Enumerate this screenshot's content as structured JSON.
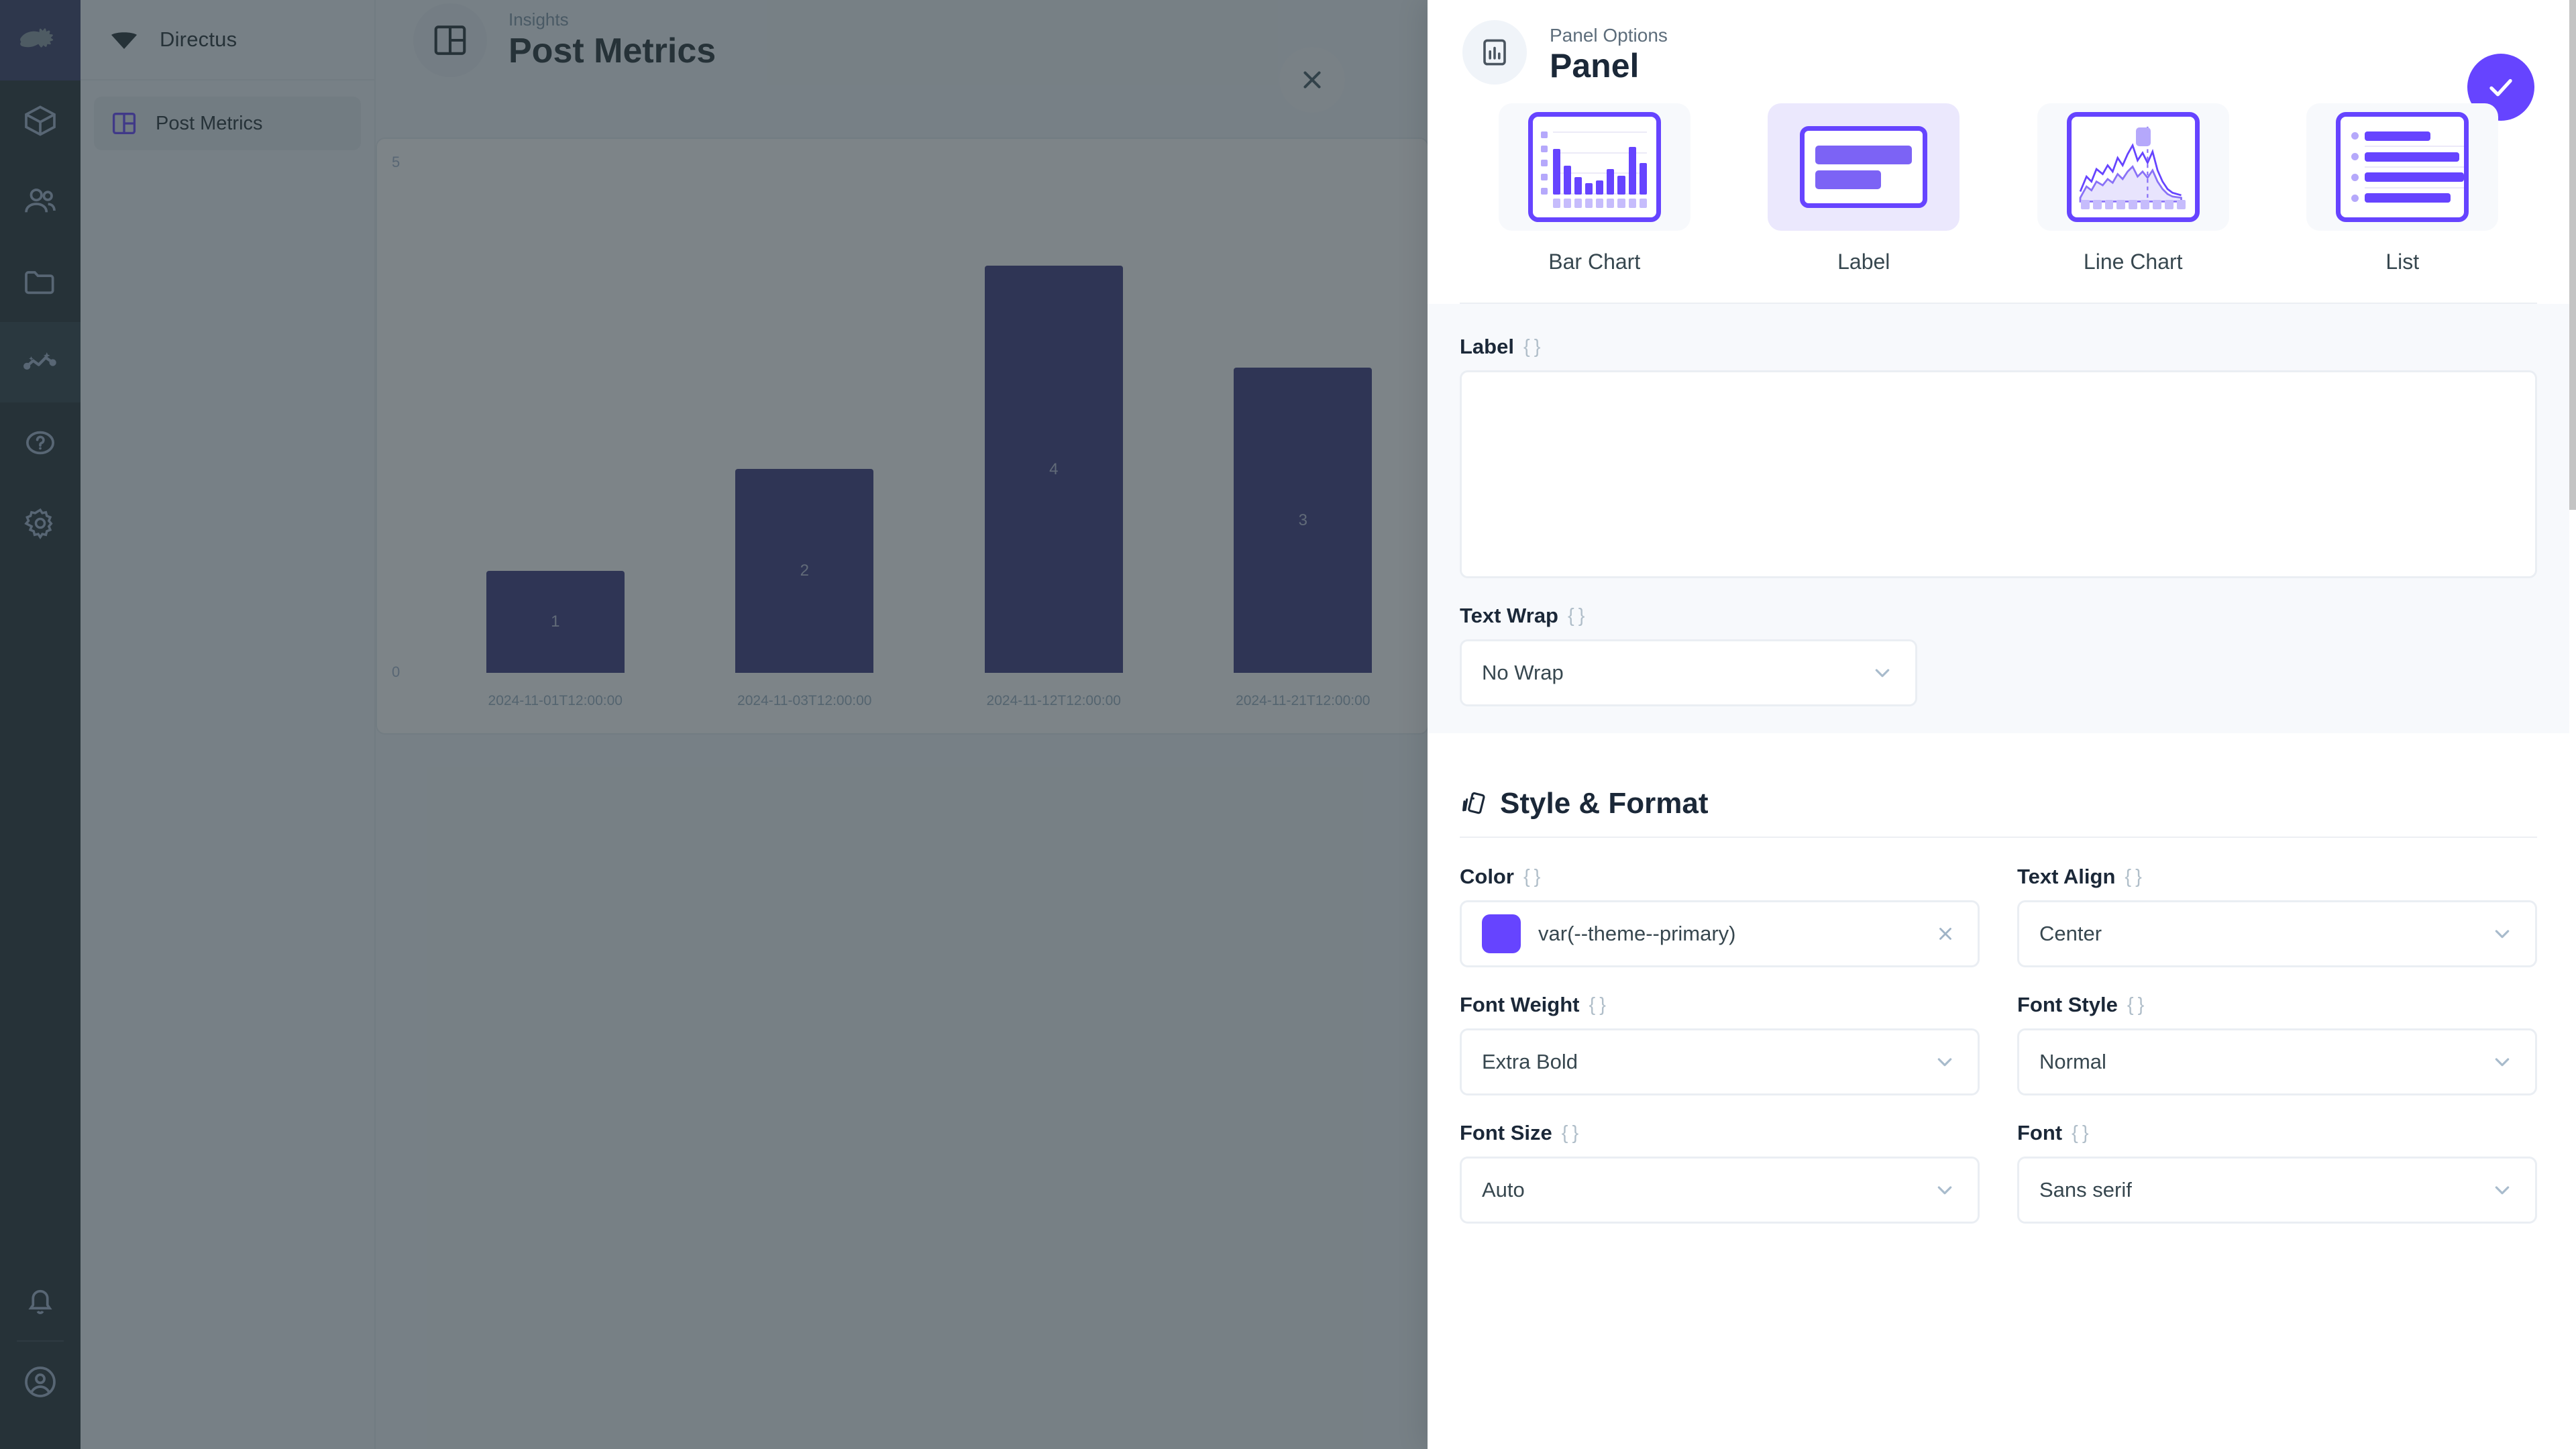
{
  "module_bar": {
    "logo_name": "directus-rabbit-logo",
    "items": [
      {
        "name": "content-module",
        "icon": "box-icon",
        "active": false
      },
      {
        "name": "users-module",
        "icon": "people-icon",
        "active": false
      },
      {
        "name": "files-module",
        "icon": "folder-icon",
        "active": false
      },
      {
        "name": "insights-module",
        "icon": "insights-chart-icon",
        "active": true
      },
      {
        "name": "docs-module",
        "icon": "question-circle-icon",
        "active": false
      },
      {
        "name": "settings-module",
        "icon": "gear-icon",
        "active": false
      }
    ],
    "bottom_items": [
      {
        "name": "notifications",
        "icon": "bell-icon"
      },
      {
        "name": "account",
        "icon": "user-circle-icon"
      }
    ]
  },
  "nav": {
    "brand": "Directus",
    "items": [
      {
        "label": "Post Metrics",
        "icon": "dashboard-icon",
        "active": true
      }
    ]
  },
  "main_header": {
    "breadcrumb": "Insights",
    "title": "Post Metrics",
    "icon": "dashboard-icon",
    "close_label": "close-icon"
  },
  "chart_data": {
    "type": "bar",
    "title": "Post Metrics",
    "categories": [
      "2024-11-01T12:00:00",
      "2024-11-03T12:00:00",
      "2024-11-12T12:00:00",
      "2024-11-21T12:00:00"
    ],
    "values": [
      1,
      2,
      4,
      3
    ],
    "xlabel": "",
    "ylabel": "",
    "ylim": [
      0,
      5
    ],
    "yticks": [
      "0",
      "5"
    ],
    "grid": false,
    "legend": "none",
    "bar_color": "#3d3b80"
  },
  "drawer": {
    "subtitle": "Panel Options",
    "title": "Panel",
    "icon": "panel-chart-icon",
    "save_label": "check-icon",
    "accent_color": "#6644ff",
    "panel_types": [
      {
        "label": "Bar Chart",
        "icon": "bar-chart-thumb",
        "selected": false
      },
      {
        "label": "Label",
        "icon": "label-thumb",
        "selected": true
      },
      {
        "label": "Line Chart",
        "icon": "line-chart-thumb",
        "selected": false
      },
      {
        "label": "List",
        "icon": "list-thumb",
        "selected": false
      }
    ],
    "fields": {
      "label": {
        "label": "Label",
        "braces": "{ }",
        "value": "",
        "placeholder": ""
      },
      "text_wrap": {
        "label": "Text Wrap",
        "braces": "{ }",
        "value": "No Wrap"
      }
    },
    "style_section": {
      "title": "Style & Format",
      "icon": "palette-icon",
      "color": {
        "label": "Color",
        "braces": "{ }",
        "value": "var(--theme--primary)",
        "swatch": "#6644ff",
        "clear": "clear-icon"
      },
      "text_align": {
        "label": "Text Align",
        "braces": "{ }",
        "value": "Center"
      },
      "font_weight": {
        "label": "Font Weight",
        "braces": "{ }",
        "value": "Extra Bold"
      },
      "font_style": {
        "label": "Font Style",
        "braces": "{ }",
        "value": "Normal"
      },
      "font_size": {
        "label": "Font Size",
        "braces": "{ }",
        "value": "Auto"
      },
      "font": {
        "label": "Font",
        "braces": "{ }",
        "value": "Sans serif"
      }
    }
  }
}
